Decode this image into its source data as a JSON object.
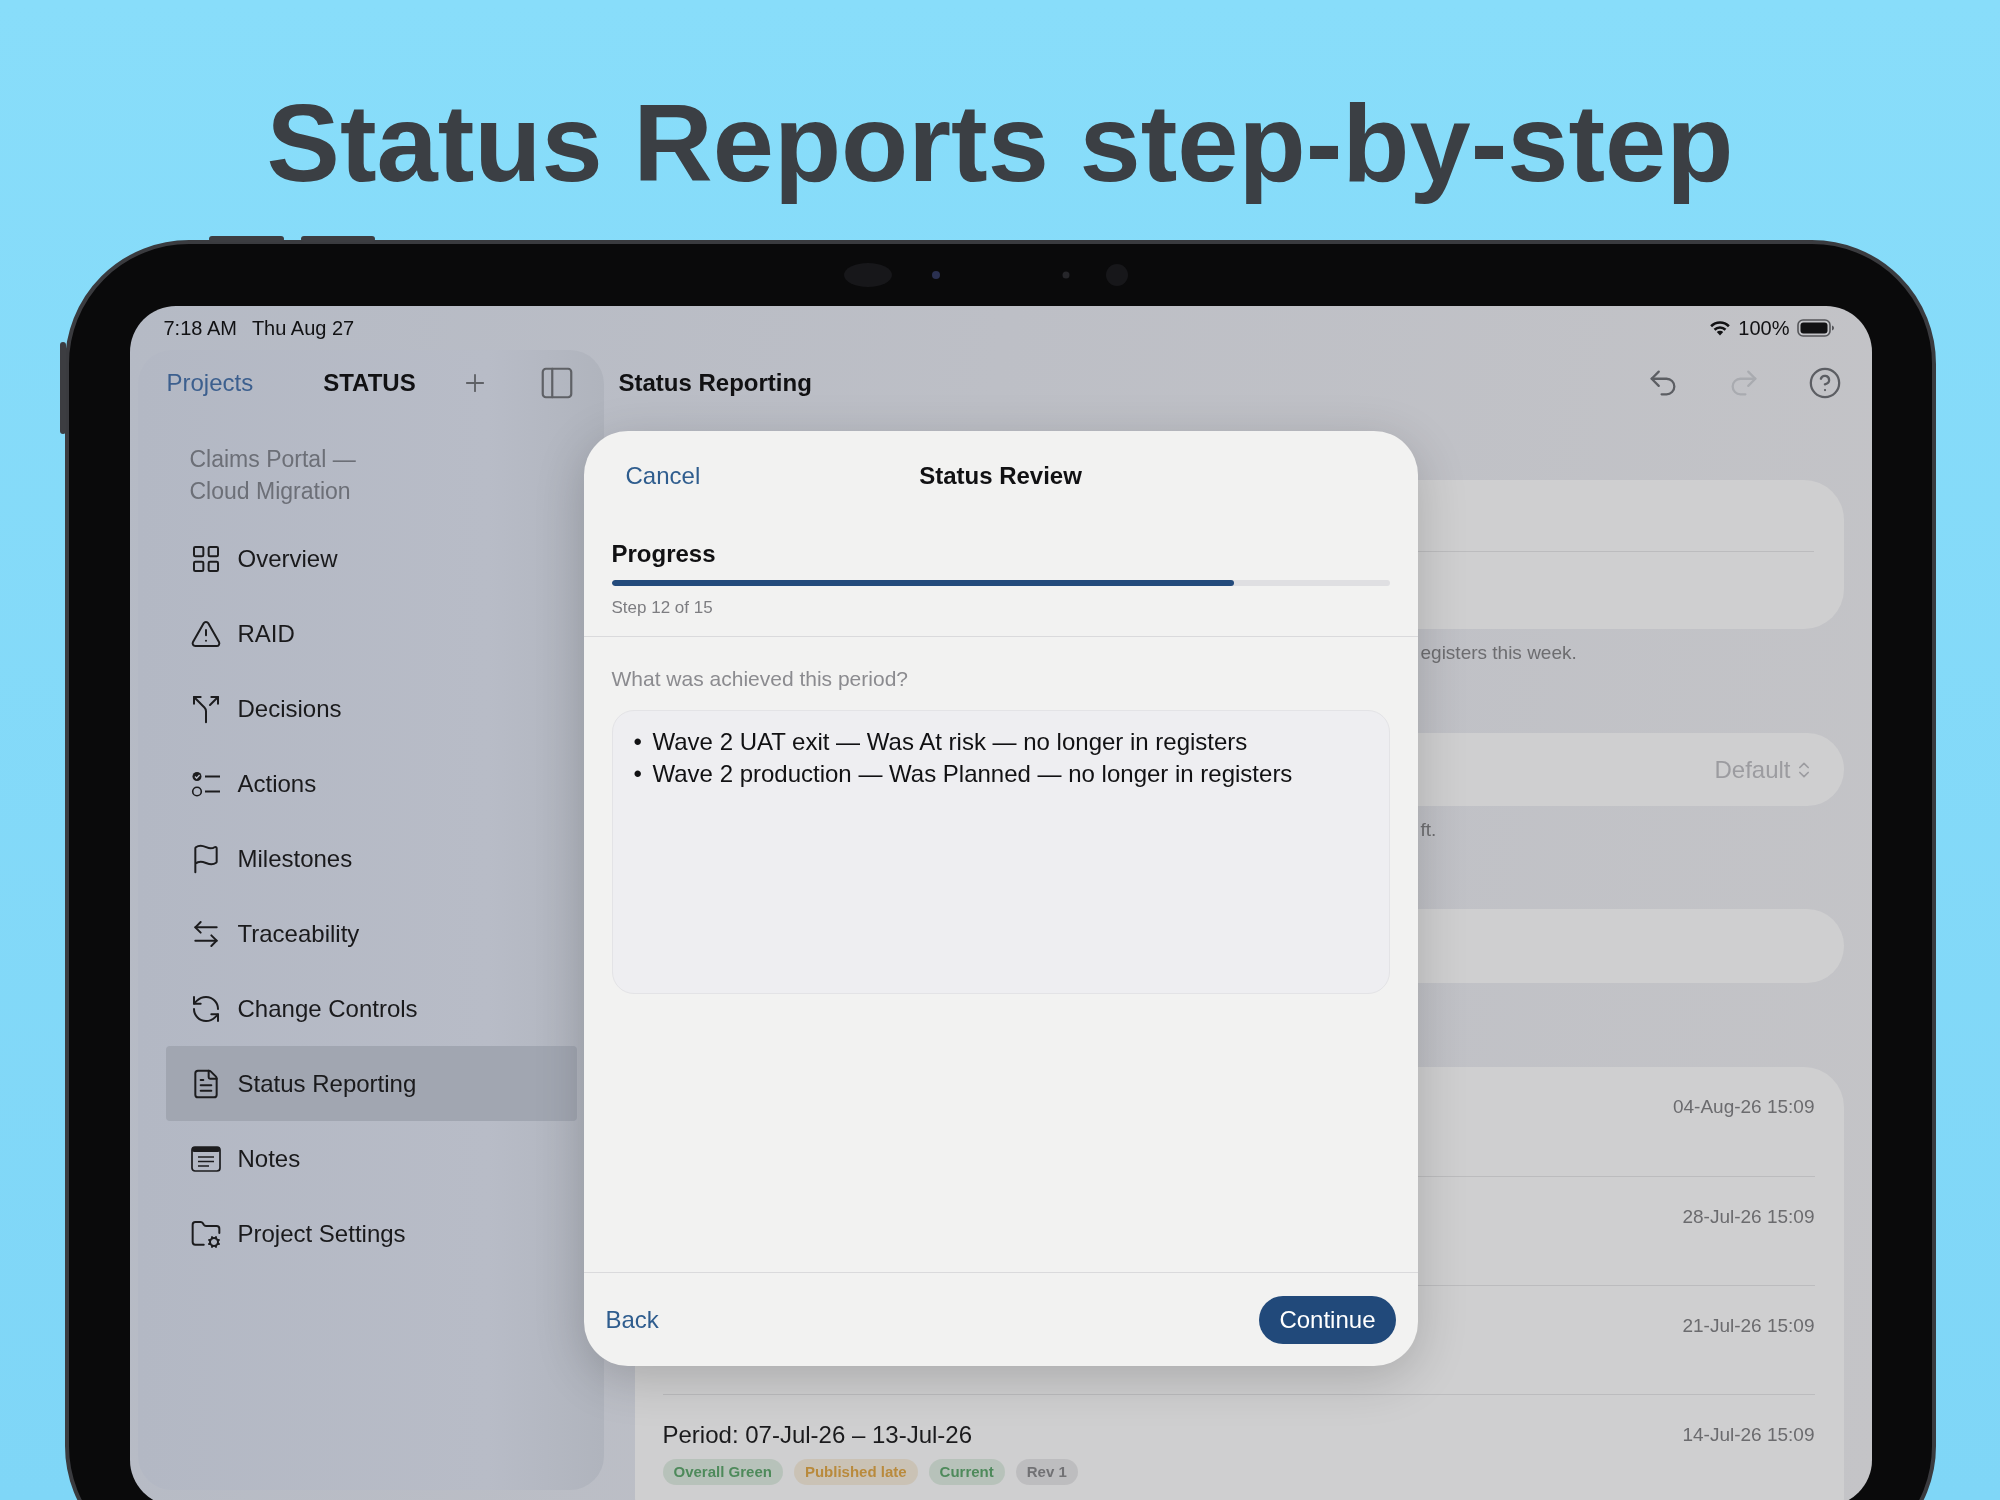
{
  "headline": "Status Reports step-by-step",
  "status_bar": {
    "time": "7:18 AM",
    "date": "Thu Aug 27",
    "battery": "100%"
  },
  "sidebar": {
    "toolbar": {
      "back": "Projects",
      "title": "STATUS"
    },
    "project": "Claims Portal — Cloud Migration",
    "items": [
      {
        "label": "Overview",
        "selected": false
      },
      {
        "label": "RAID",
        "selected": false
      },
      {
        "label": "Decisions",
        "selected": false
      },
      {
        "label": "Actions",
        "selected": false
      },
      {
        "label": "Milestones",
        "selected": false
      },
      {
        "label": "Traceability",
        "selected": false
      },
      {
        "label": "Change Controls",
        "selected": false
      },
      {
        "label": "Status Reporting",
        "selected": true
      },
      {
        "label": "Notes",
        "selected": false
      },
      {
        "label": "Project Settings",
        "selected": false
      }
    ]
  },
  "toolbar": {
    "title": "Status Reporting",
    "actions": [
      {
        "kind": "undo",
        "disabled": false
      },
      {
        "kind": "redo",
        "disabled": true
      },
      {
        "kind": "help",
        "disabled": false
      }
    ]
  },
  "content": [
    {
      "kind": "split_card"
    },
    {
      "kind": "footnote",
      "text": "egisters this week."
    },
    {
      "kind": "picker_card",
      "value": "Default"
    },
    {
      "kind": "footnote",
      "text": "ft."
    },
    {
      "kind": "plain_card"
    },
    {
      "kind": "report_list",
      "rows": [
        {
          "date": "04-Aug-26 15:09"
        },
        {
          "date": "28-Jul-26 15:09"
        },
        {
          "date": "21-Jul-26 15:09"
        },
        {
          "period": "Period: 07-Jul-26 – 13-Jul-26",
          "date": "14-Jul-26 15:09",
          "tags": [
            {
              "label": "Overall Green",
              "color": "#4e8a5b"
            },
            {
              "label": "Published late",
              "color": "#b98a3c"
            },
            {
              "label": "Current",
              "color": "#4e8a5b"
            },
            {
              "label": "Rev 1",
              "color": "#717174"
            }
          ]
        }
      ]
    }
  ],
  "modal": {
    "cancel": "Cancel",
    "title": "Status Review",
    "section": "Progress",
    "progress": {
      "level": 0.8,
      "caption": "Step 12 of 15"
    },
    "question": "What was achieved this period?",
    "answer": [
      {
        "bullet": "•",
        "text": "Wave 2 UAT exit — Was At risk — no longer in registers"
      },
      {
        "bullet": "•",
        "text": "Wave 2 production — Was Planned — no longer in registers"
      }
    ],
    "back": "Back",
    "continue": "Continue"
  }
}
